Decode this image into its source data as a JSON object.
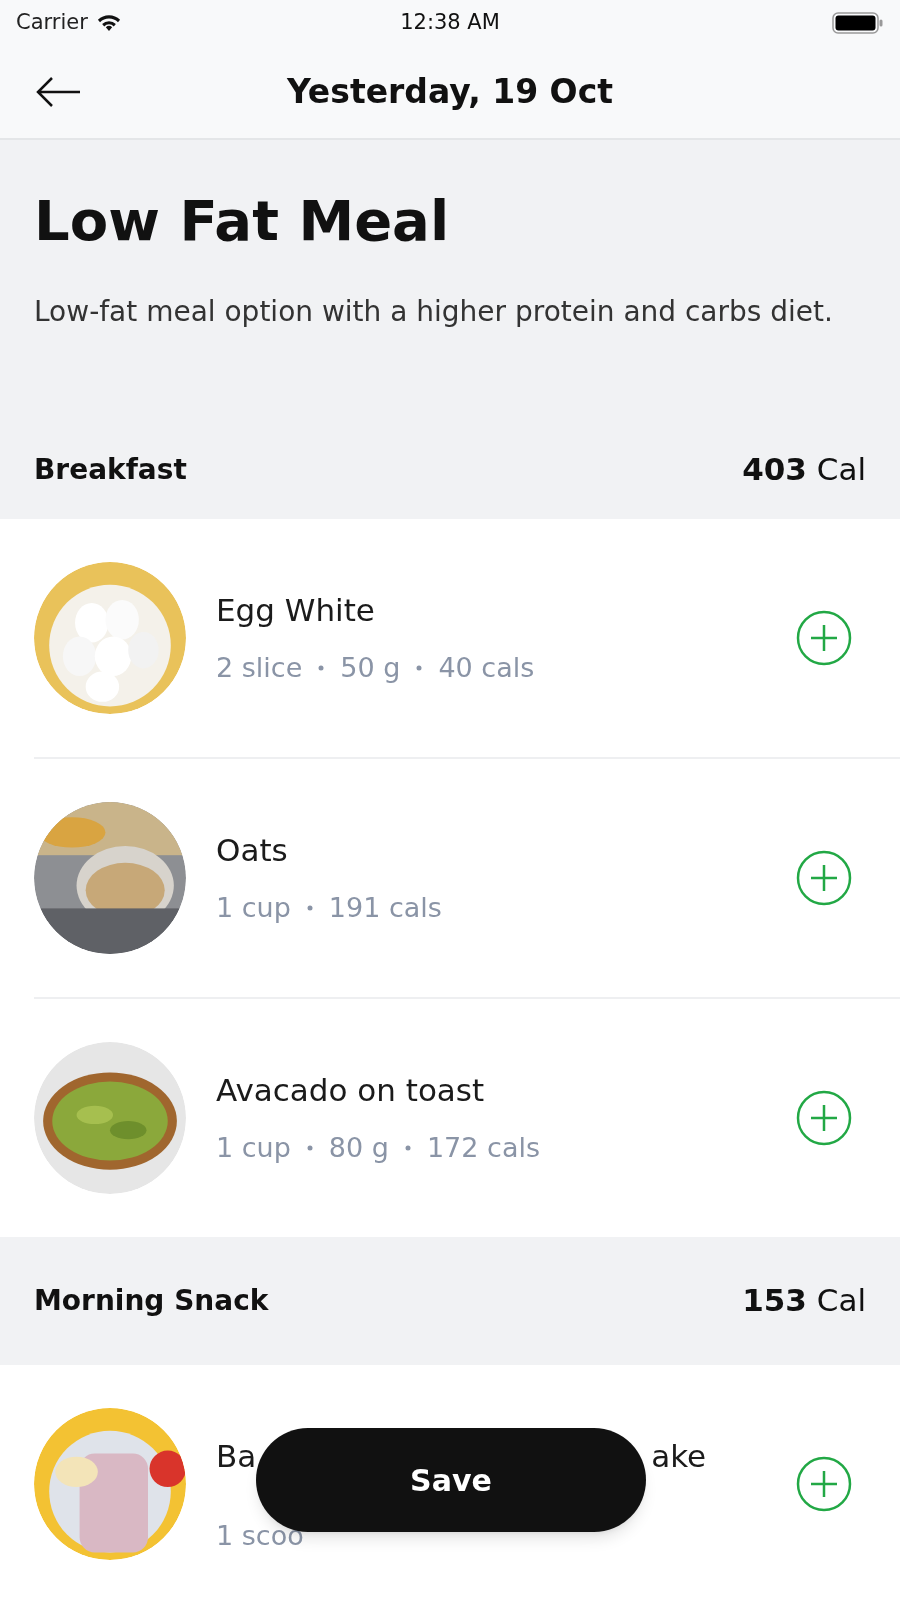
{
  "status_bar": {
    "carrier": "Carrier",
    "time": "12:38 AM"
  },
  "nav": {
    "title": "Yesterday, 19 Oct"
  },
  "meal": {
    "title": "Low Fat Meal",
    "description": "Low-fat meal option with a higher protein and carbs diet."
  },
  "sections": [
    {
      "name": "Breakfast",
      "calories_value": "403",
      "calories_unit": "Cal",
      "items": [
        {
          "name_parts": [
            "Egg White"
          ],
          "meta": [
            "2 slice",
            "50 g",
            "40 cals"
          ]
        },
        {
          "name_parts": [
            "Oats"
          ],
          "meta": [
            "1 cup",
            "191 cals"
          ]
        },
        {
          "name_parts": [
            "Avacado on toast"
          ],
          "meta": [
            "1 cup",
            "80 g",
            "172 cals"
          ]
        }
      ]
    },
    {
      "name": "Morning Snack",
      "calories_value": "153",
      "calories_unit": "Cal",
      "items": [
        {
          "name_parts": [
            "Ba",
            "ake"
          ],
          "meta": [
            "1 scoo"
          ]
        }
      ]
    }
  ],
  "save_button": {
    "label": "Save"
  }
}
